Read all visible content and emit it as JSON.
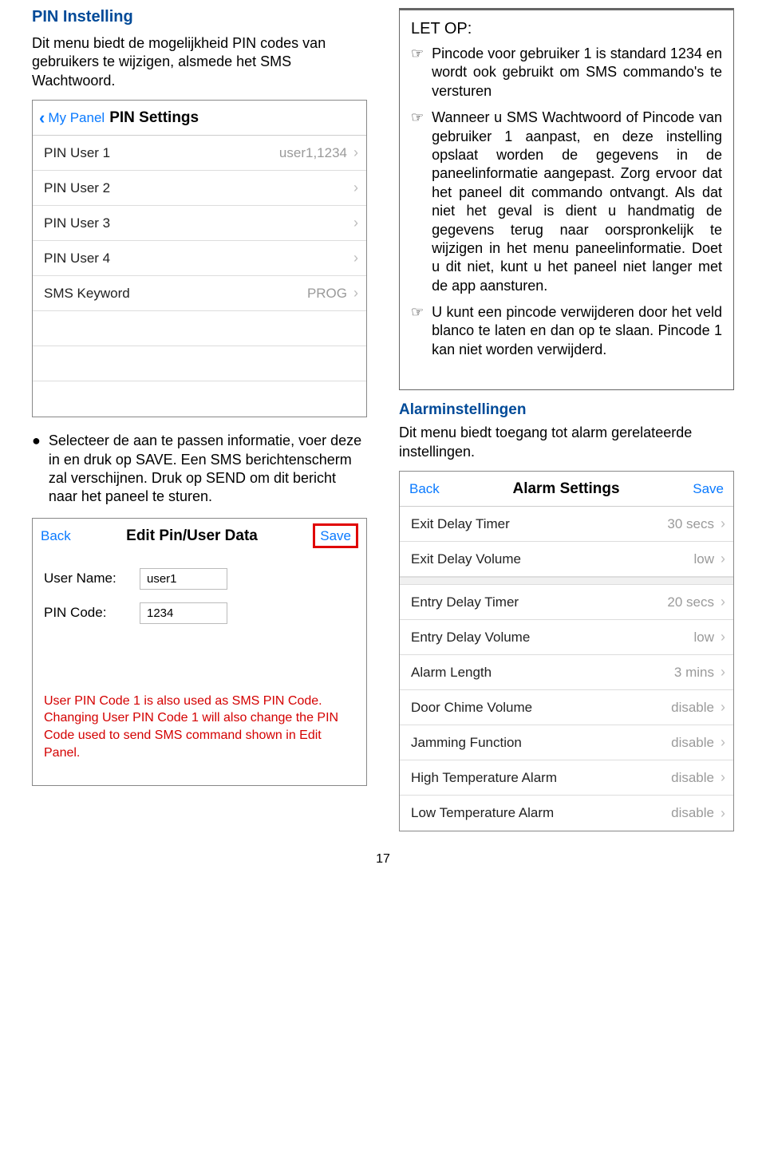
{
  "left": {
    "heading": "PIN Instelling",
    "intro": "Dit menu biedt de mogelijkheid PIN codes van gebruikers te wijzigen, alsmede het SMS Wachtwoord.",
    "pinPanel": {
      "back": "My Panel",
      "title": "PIN Settings",
      "rows": [
        {
          "label": "PIN User 1",
          "value": "user1,1234"
        },
        {
          "label": "PIN User 2",
          "value": ""
        },
        {
          "label": "PIN User 3",
          "value": ""
        },
        {
          "label": "PIN User 4",
          "value": ""
        },
        {
          "label": "SMS Keyword",
          "value": "PROG"
        }
      ]
    },
    "bullet": "Selecteer de aan te passen informatie, voer deze in en druk op SAVE. Een SMS berichtenscherm zal verschijnen. Druk op SEND om dit bericht naar het paneel te sturen.",
    "editPanel": {
      "back": "Back",
      "title": "Edit Pin/User Data",
      "save": "Save",
      "userNameLabel": "User Name:",
      "userNameValue": "user1",
      "pinCodeLabel": "PIN Code:",
      "pinCodeValue": "1234",
      "redNote": "User PIN Code 1 is also used as SMS PIN Code. Changing User PIN Code 1 will also change the PIN Code used to send SMS command shown in Edit Panel."
    }
  },
  "right": {
    "noticeTitle": "LET OP:",
    "notices": [
      "Pincode voor gebruiker 1 is standard 1234 en wordt ook gebruikt om SMS commando's te versturen",
      "Wanneer u SMS Wachtwoord of Pincode van gebruiker 1 aanpast, en deze instelling opslaat worden de gegevens in de paneelinformatie aangepast. Zorg ervoor dat het paneel dit commando ontvangt. Als dat niet het geval is dient u handmatig de gegevens terug naar oorspronkelijk te wijzigen in het menu paneelinformatie. Doet u dit niet, kunt u het paneel niet langer met de app aansturen.",
      "U kunt een pincode verwijderen door het veld blanco te laten en dan op te slaan. Pincode 1 kan niet worden verwijderd."
    ],
    "alarmHeading": "Alarminstellingen",
    "alarmIntro": "Dit menu biedt toegang tot alarm gerelateerde instellingen.",
    "alarmPanel": {
      "back": "Back",
      "title": "Alarm Settings",
      "save": "Save",
      "rows": [
        {
          "label": "Exit Delay Timer",
          "value": "30 secs"
        },
        {
          "label": "Exit Delay Volume",
          "value": "low"
        },
        {
          "label": "Entry Delay Timer",
          "value": "20 secs"
        },
        {
          "label": "Entry Delay Volume",
          "value": "low"
        },
        {
          "label": "Alarm Length",
          "value": "3 mins"
        },
        {
          "label": "Door Chime Volume",
          "value": "disable"
        },
        {
          "label": "Jamming Function",
          "value": "disable"
        },
        {
          "label": "High Temperature Alarm",
          "value": "disable"
        },
        {
          "label": "Low Temperature Alarm",
          "value": "disable"
        }
      ]
    }
  },
  "pageNumber": "17"
}
